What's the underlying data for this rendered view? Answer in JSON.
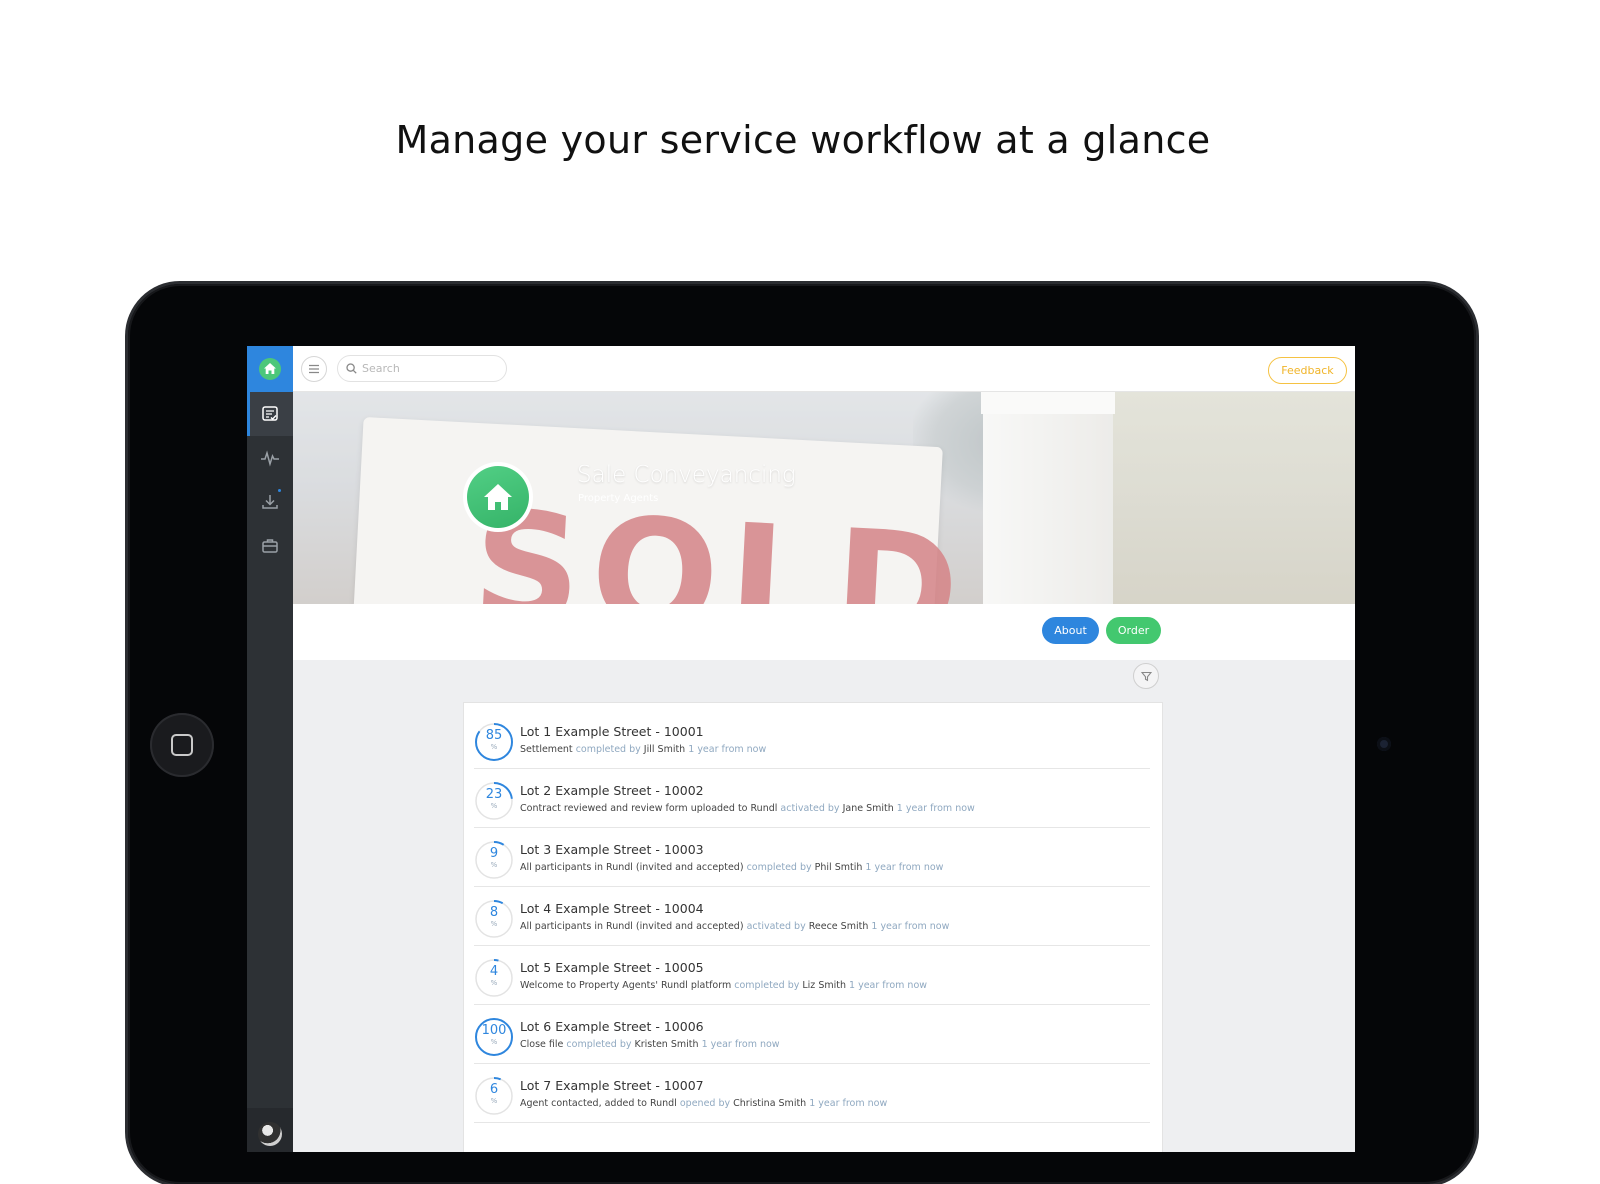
{
  "headline": "Manage your service workflow at a glance",
  "topbar": {
    "search_placeholder": "Search",
    "feedback_label": "Feedback"
  },
  "sidebar": {
    "items": [
      {
        "icon": "checklist-icon",
        "active": true
      },
      {
        "icon": "activity-icon",
        "active": false
      },
      {
        "icon": "download-icon",
        "active": false
      },
      {
        "icon": "briefcase-icon",
        "active": false
      }
    ]
  },
  "hero": {
    "title": "Sale Conveyancing",
    "subtitle": "Property Agents",
    "sign_text": "SOLD"
  },
  "actions": {
    "about_label": "About",
    "order_label": "Order"
  },
  "colors": {
    "primary": "#2e86de",
    "success": "#43c86f",
    "feedback": "#f0b429",
    "sidebar": "#2d3135"
  },
  "workflows": [
    {
      "title": "Lot 1 Example Street - 10001",
      "progress": 85,
      "task": "Settlement",
      "verb": "completed by",
      "person": "Jill Smith",
      "time": "1 year from now"
    },
    {
      "title": "Lot 2 Example Street - 10002",
      "progress": 23,
      "task": "Contract reviewed and review form uploaded to Rundl",
      "verb": "activated by",
      "person": "Jane Smith",
      "time": "1 year from now"
    },
    {
      "title": "Lot 3 Example Street - 10003",
      "progress": 9,
      "task": "All participants in Rundl (invited and accepted)",
      "verb": "completed by",
      "person": "Phil Smtih",
      "time": "1 year from now"
    },
    {
      "title": "Lot 4 Example Street - 10004",
      "progress": 8,
      "task": "All participants in Rundl (invited and accepted)",
      "verb": "activated by",
      "person": "Reece Smith",
      "time": "1 year from now"
    },
    {
      "title": "Lot 5 Example Street - 10005",
      "progress": 4,
      "task": "Welcome to Property Agents' Rundl platform",
      "verb": "completed by",
      "person": "Liz Smith",
      "time": "1 year from now"
    },
    {
      "title": "Lot 6 Example Street - 10006",
      "progress": 100,
      "task": "Close file",
      "verb": "completed by",
      "person": "Kristen Smith",
      "time": "1 year from now"
    },
    {
      "title": "Lot 7 Example Street - 10007",
      "progress": 6,
      "task": "Agent contacted, added to Rundl",
      "verb": "opened by",
      "person": "Christina Smith",
      "time": "1 year from now"
    }
  ]
}
